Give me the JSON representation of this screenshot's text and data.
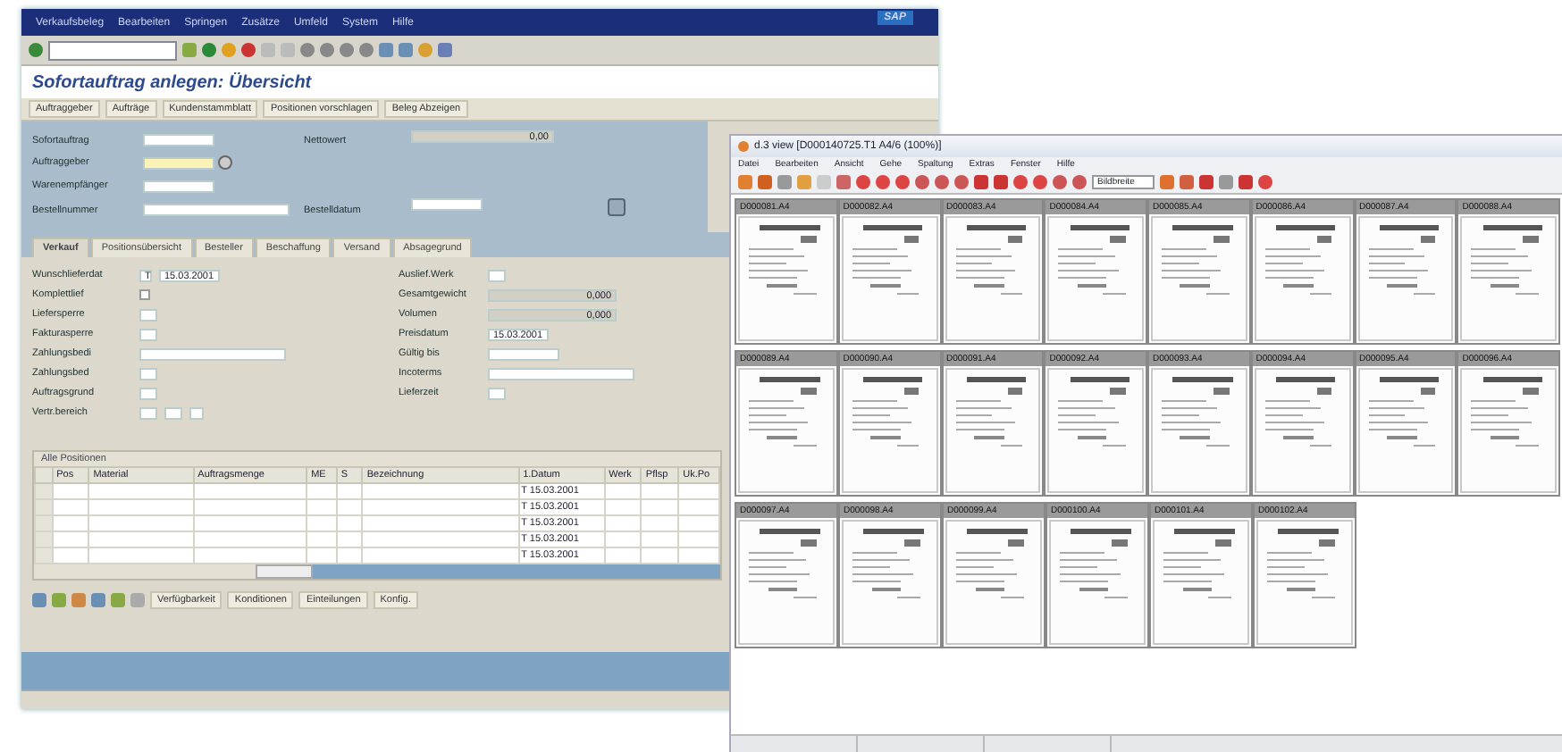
{
  "sap_window": {
    "menu": [
      "Verkaufsbeleg",
      "Bearbeiten",
      "Springen",
      "Zusätze",
      "Umfeld",
      "System",
      "Hilfe"
    ],
    "logo": "SAP",
    "title": "Sofortauftrag anlegen: Übersicht",
    "app_toolbar": [
      "Auftraggeber",
      "Aufträge",
      "Kundenstammblatt",
      "Positionen vorschlagen",
      "Beleg Abzeigen"
    ],
    "header_fields": [
      {
        "label": "Sofortauftrag",
        "kind": "input"
      },
      {
        "label": "Auftraggeber",
        "kind": "required"
      },
      {
        "label": "Warenempfänger",
        "kind": "input"
      },
      {
        "label": "Bestellnummer",
        "kind": "wide"
      }
    ],
    "net_value": {
      "label": "Nettowert",
      "value": "0,00"
    },
    "order_date": {
      "label": "Bestelldatum"
    },
    "tabs": [
      {
        "label": "Verkauf",
        "selected": true
      },
      {
        "label": "Positionsübersicht",
        "selected": false
      },
      {
        "label": "Besteller",
        "selected": false
      },
      {
        "label": "Beschaffung",
        "selected": false
      },
      {
        "label": "Versand",
        "selected": false
      },
      {
        "label": "Absagegrund",
        "selected": false
      }
    ],
    "left_fields": [
      {
        "label": "Wunschlieferdat",
        "kind": "date",
        "prefix": "T",
        "value": "15.03.2001"
      },
      {
        "label": "Komplettlief",
        "kind": "checkbox",
        "checked": false
      },
      {
        "label": "Liefersperre",
        "kind": "short"
      },
      {
        "label": "Fakturasperre",
        "kind": "short"
      },
      {
        "label": "Zahlungsbedi",
        "kind": "wide"
      },
      {
        "label": "Zahlungsbed",
        "kind": "short"
      },
      {
        "label": "Auftragsgrund",
        "kind": "short"
      },
      {
        "label": "Vertr.bereich",
        "kind": "multi"
      }
    ],
    "right_fields": [
      {
        "label": "Auslief.Werk",
        "kind": "short"
      },
      {
        "label": "Gesamtgewicht",
        "kind": "display",
        "value": "0,000"
      },
      {
        "label": "Volumen",
        "kind": "display",
        "value": "0,000"
      },
      {
        "label": "Preisdatum",
        "kind": "date",
        "value": "15.03.2001"
      },
      {
        "label": "Gültig bis",
        "kind": "medium"
      },
      {
        "label": "Incoterms",
        "kind": "wide"
      },
      {
        "label": "Lieferzeit",
        "kind": "short"
      }
    ],
    "items_table": {
      "title": "Alle Positionen",
      "columns": [
        "Pos",
        "Material",
        "Auftragsmenge",
        "ME",
        "S",
        "Bezeichnung",
        "1.Datum",
        "Werk",
        "Pflsp",
        "Uk.Po"
      ],
      "rows": [
        {
          "unit": "T",
          "date": "15.03.2001"
        },
        {
          "unit": "T",
          "date": "15.03.2001"
        },
        {
          "unit": "T",
          "date": "15.03.2001"
        },
        {
          "unit": "T",
          "date": "15.03.2001"
        },
        {
          "unit": "T",
          "date": "15.03.2001"
        }
      ]
    },
    "bottom_buttons": [
      "Verfügbarkeit",
      "Konditionen",
      "Einteilungen",
      "Konfig."
    ]
  },
  "viewer_window": {
    "title": "d.3 view [D000140725.T1 A4/6 (100%)]",
    "menu": [
      "Datei",
      "Bearbeiten",
      "Ansicht",
      "Gehe",
      "Spaltung",
      "Extras",
      "Fenster",
      "Hilfe"
    ],
    "zoom_select": "Bildbreite",
    "thumbnail_rows": [
      [
        "D000081.A4",
        "D000082.A4",
        "D000083.A4",
        "D000084.A4",
        "D000085.A4",
        "D000086.A4",
        "D000087.A4",
        "D000088.A4"
      ],
      [
        "D000089.A4",
        "D000090.A4",
        "D000091.A4",
        "D000092.A4",
        "D000093.A4",
        "D000094.A4",
        "D000095.A4",
        "D000096.A4"
      ],
      [
        "D000097.A4",
        "D000098.A4",
        "D000099.A4",
        "D000100.A4",
        "D000101.A4",
        "D000102.A4"
      ]
    ]
  }
}
